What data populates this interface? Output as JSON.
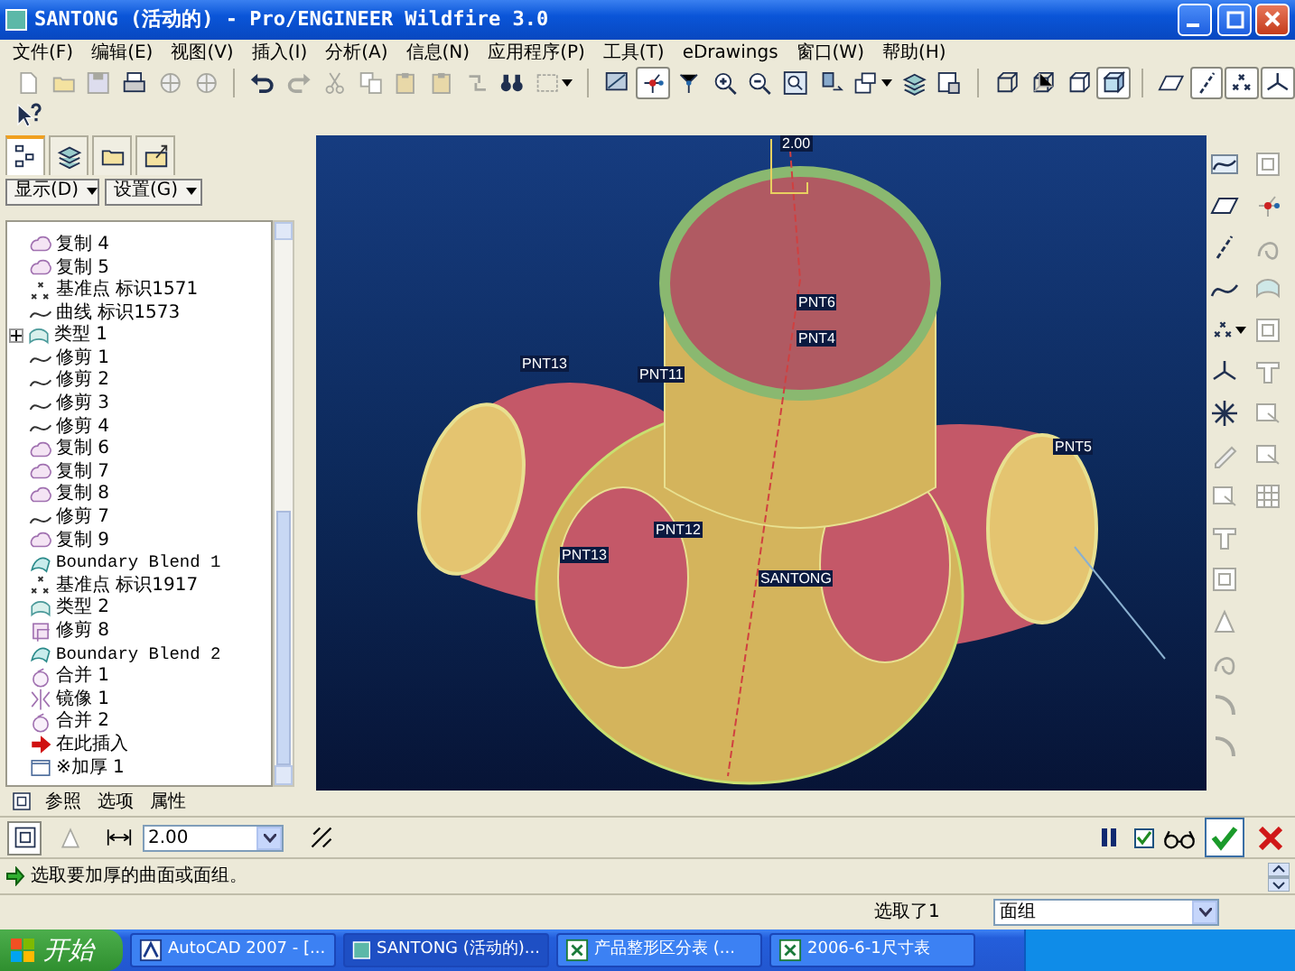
{
  "window": {
    "title": "SANTONG (活动的) - Pro/ENGINEER Wildfire 3.0"
  },
  "menu": [
    {
      "label": "文件(F)"
    },
    {
      "label": "编辑(E)"
    },
    {
      "label": "视图(V)"
    },
    {
      "label": "插入(I)"
    },
    {
      "label": "分析(A)"
    },
    {
      "label": "信息(N)"
    },
    {
      "label": "应用程序(P)"
    },
    {
      "label": "工具(T)"
    },
    {
      "label": "eDrawings"
    },
    {
      "label": "窗口(W)"
    },
    {
      "label": "帮助(H)"
    }
  ],
  "toolbar": [
    [
      {
        "kind": "page",
        "disabled": true,
        "on": false
      },
      {
        "kind": "folder",
        "disabled": true,
        "on": false
      },
      {
        "kind": "disk",
        "disabled": true,
        "on": false
      },
      {
        "kind": "printer",
        "disabled": false,
        "on": false
      },
      {
        "kind": "globe",
        "disabled": true,
        "on": false
      },
      {
        "kind": "globe",
        "disabled": true,
        "on": false
      }
    ],
    [
      {
        "kind": "undo-arrow",
        "disabled": false,
        "on": false
      },
      {
        "kind": "redo-arrow",
        "disabled": true,
        "on": false
      },
      {
        "kind": "scissors",
        "disabled": true,
        "on": false
      },
      {
        "kind": "copy",
        "disabled": true,
        "on": false
      },
      {
        "kind": "clipboard",
        "disabled": true,
        "on": false
      },
      {
        "kind": "clipboard",
        "disabled": true,
        "on": false
      },
      {
        "kind": "regenerate",
        "disabled": true,
        "on": false
      },
      {
        "kind": "binoculars",
        "disabled": false,
        "on": false
      },
      {
        "kind": "dashed-box",
        "disabled": true,
        "on": false,
        "menu": true
      }
    ],
    [
      {
        "kind": "monitor",
        "disabled": false,
        "on": false
      },
      {
        "kind": "spin-nodes",
        "disabled": false,
        "on": true
      },
      {
        "kind": "orient-nodes",
        "disabled": false,
        "on": false
      },
      {
        "kind": "zoom-in",
        "disabled": false,
        "on": false
      },
      {
        "kind": "zoom-out",
        "disabled": false,
        "on": false
      },
      {
        "kind": "zoom-fit",
        "disabled": false,
        "on": false
      },
      {
        "kind": "reorient",
        "disabled": false,
        "on": false
      },
      {
        "kind": "saved-views",
        "disabled": false,
        "on": false,
        "menu": true
      },
      {
        "kind": "layers",
        "disabled": false,
        "on": false
      },
      {
        "kind": "display-settings",
        "disabled": false,
        "on": false
      }
    ],
    [
      {
        "kind": "wireframe-cube",
        "disabled": false,
        "on": false
      },
      {
        "kind": "hidden-cube",
        "disabled": false,
        "on": false
      },
      {
        "kind": "no-hidden-cube",
        "disabled": false,
        "on": false
      },
      {
        "kind": "shaded-cube",
        "disabled": false,
        "on": true
      }
    ],
    [
      {
        "kind": "plane",
        "disabled": false,
        "on": false
      },
      {
        "kind": "axis",
        "disabled": false,
        "on": true
      },
      {
        "kind": "points",
        "disabled": false,
        "on": true
      },
      {
        "kind": "csys",
        "disabled": false,
        "on": true
      }
    ]
  ],
  "toolbar_2": [
    {
      "kind": "help-cursor",
      "disabled": false,
      "on": false
    }
  ],
  "model_tree": {
    "tabs": [
      {
        "kind": "tree",
        "selected": true
      },
      {
        "kind": "layers",
        "selected": false
      },
      {
        "kind": "folder",
        "selected": false
      },
      {
        "kind": "favorites",
        "selected": false
      }
    ],
    "buttons": [
      {
        "label": "显示(D)"
      },
      {
        "label": "设置(G)"
      }
    ],
    "items": [
      {
        "kind": "copy",
        "label": "复制 4",
        "collapsed": false
      },
      {
        "kind": "copy",
        "label": "复制 5",
        "collapsed": false
      },
      {
        "kind": "point",
        "label": "基准点 标识1571",
        "collapsed": false
      },
      {
        "kind": "curve",
        "label": "曲线 标识1573",
        "collapsed": false
      },
      {
        "kind": "surface",
        "label": "类型 1",
        "collapsed": true
      },
      {
        "kind": "curve",
        "label": "修剪 1",
        "collapsed": false
      },
      {
        "kind": "curve",
        "label": "修剪 2",
        "collapsed": false
      },
      {
        "kind": "curve",
        "label": "修剪 3",
        "collapsed": false
      },
      {
        "kind": "curve",
        "label": "修剪 4",
        "collapsed": false
      },
      {
        "kind": "copy",
        "label": "复制 6",
        "collapsed": false
      },
      {
        "kind": "copy",
        "label": "复制 7",
        "collapsed": false
      },
      {
        "kind": "copy",
        "label": "复制 8",
        "collapsed": false
      },
      {
        "kind": "curve",
        "label": "修剪 7",
        "collapsed": false
      },
      {
        "kind": "copy",
        "label": "复制 9",
        "collapsed": false
      },
      {
        "kind": "blend",
        "label": "Boundary Blend 1",
        "collapsed": false
      },
      {
        "kind": "point",
        "label": "基准点 标识1917",
        "collapsed": false
      },
      {
        "kind": "surface",
        "label": "类型 2",
        "collapsed": false
      },
      {
        "kind": "trim",
        "label": "修剪 8",
        "collapsed": false
      },
      {
        "kind": "blend",
        "label": "Boundary Blend 2",
        "collapsed": false
      },
      {
        "kind": "merge",
        "label": "合并 1",
        "collapsed": false
      },
      {
        "kind": "mirror",
        "label": "镜像 1",
        "collapsed": false
      },
      {
        "kind": "merge",
        "label": "合并 2",
        "collapsed": false
      },
      {
        "kind": "insert",
        "label": "在此插入",
        "collapsed": false
      },
      {
        "kind": "thicken",
        "label": "※加厚 1",
        "collapsed": false
      }
    ]
  },
  "viewport": {
    "labels": [
      {
        "text": "2.00"
      },
      {
        "text": "PNT6"
      },
      {
        "text": "PNT4"
      },
      {
        "text": "PNT13"
      },
      {
        "text": "PNT11"
      },
      {
        "text": "PNT12"
      },
      {
        "text": "PNT13"
      },
      {
        "text": "SANTONG"
      },
      {
        "text": "PNT5"
      }
    ]
  },
  "right_toolbar": {
    "column_1": [
      {
        "kind": "sketch",
        "disabled": false
      },
      {
        "kind": "plane",
        "disabled": false
      },
      {
        "kind": "axis",
        "disabled": false
      },
      {
        "kind": "curve",
        "disabled": false
      },
      {
        "kind": "points",
        "disabled": false,
        "menu": true
      },
      {
        "kind": "csys",
        "disabled": false
      },
      {
        "kind": "analysis",
        "disabled": false
      },
      {
        "kind": "pencil",
        "disabled": true
      },
      {
        "kind": "box-arrow",
        "disabled": true
      },
      {
        "kind": "t-shape",
        "disabled": true
      },
      {
        "kind": "frame",
        "disabled": true
      },
      {
        "kind": "triangle",
        "disabled": true
      },
      {
        "kind": "swirl",
        "disabled": true
      },
      {
        "kind": "arc",
        "disabled": true
      },
      {
        "kind": "arc",
        "disabled": true
      }
    ],
    "column_2": [
      {
        "kind": "frame",
        "disabled": true
      },
      {
        "kind": "spin-nodes",
        "disabled": true
      },
      {
        "kind": "swirl",
        "disabled": true
      },
      {
        "kind": "surface",
        "disabled": true
      },
      {
        "kind": "frame",
        "disabled": true
      },
      {
        "kind": "t-shape",
        "disabled": true
      },
      {
        "kind": "box-arrow",
        "disabled": true
      },
      {
        "kind": "box-arrow",
        "disabled": true
      },
      {
        "kind": "grid",
        "disabled": true
      }
    ]
  },
  "dashboard": {
    "tabs": [
      {
        "label": "参照",
        "selected": false
      },
      {
        "label": "选项",
        "selected": false
      },
      {
        "label": "属性",
        "selected": false
      }
    ],
    "toggles": [
      {
        "kind": "solid",
        "on": true
      },
      {
        "kind": "surface",
        "on": false
      }
    ],
    "thickness": {
      "value": "2.00"
    },
    "preview": {
      "checked": true
    }
  },
  "message": "选取要加厚的曲面或面组。",
  "status_bar": {
    "selection": "选取了1",
    "filter": "面组"
  },
  "taskbar": {
    "start": "开始",
    "tasks": [
      {
        "kind": "autocad",
        "label": "AutoCAD 2007 - [...",
        "selected": false
      },
      {
        "kind": "proe",
        "label": "SANTONG (活动的)...",
        "selected": true
      },
      {
        "kind": "excel",
        "label": "产品整形区分表 (...",
        "selected": false
      },
      {
        "kind": "excel",
        "label": "2006-6-1尺寸表",
        "selected": false
      }
    ]
  }
}
